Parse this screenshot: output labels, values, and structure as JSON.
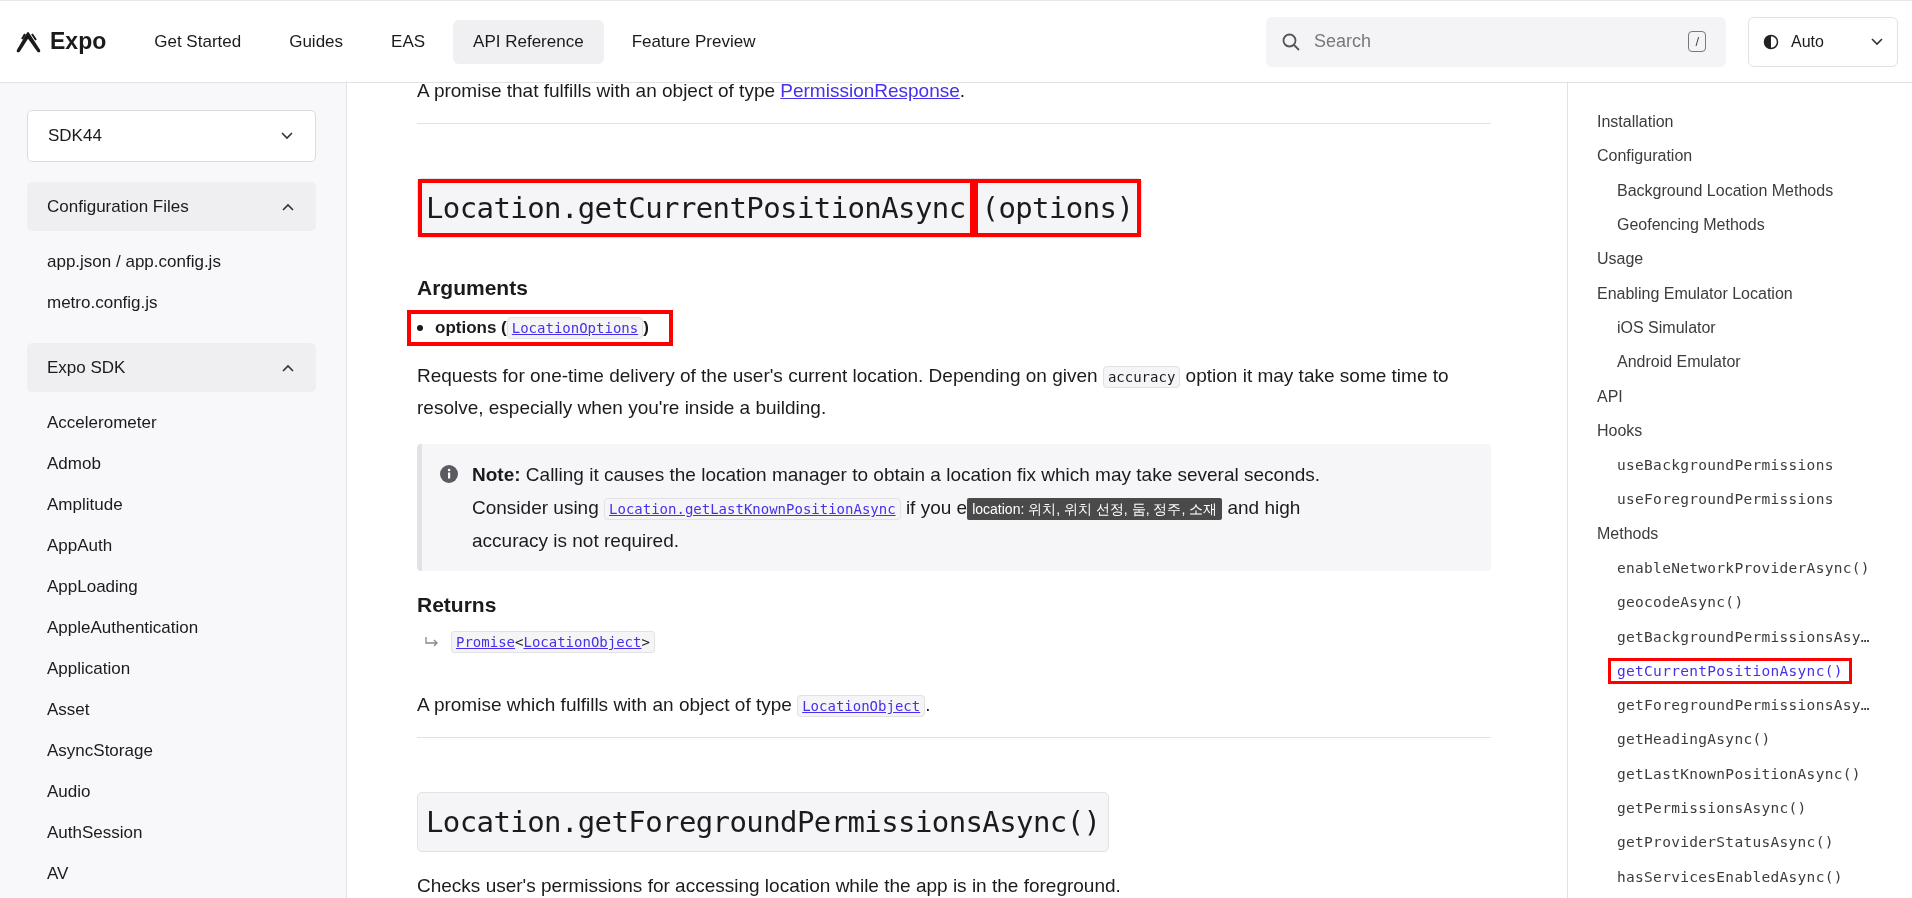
{
  "header": {
    "logo": "Expo",
    "nav": [
      {
        "label": "Get Started",
        "selected": false
      },
      {
        "label": "Guides",
        "selected": false
      },
      {
        "label": "EAS",
        "selected": false
      },
      {
        "label": "API Reference",
        "selected": true
      },
      {
        "label": "Feature Preview",
        "selected": false
      }
    ],
    "search": {
      "placeholder": "Search",
      "shortcut": "/"
    },
    "theme": {
      "value": "Auto"
    }
  },
  "sidebar": {
    "version": "SDK44",
    "sections": [
      {
        "title": "Configuration Files",
        "expanded": true,
        "items": [
          "app.json / app.config.js",
          "metro.config.js"
        ]
      },
      {
        "title": "Expo SDK",
        "expanded": true,
        "items": [
          "Accelerometer",
          "Admob",
          "Amplitude",
          "AppAuth",
          "AppLoading",
          "AppleAuthentication",
          "Application",
          "Asset",
          "AsyncStorage",
          "Audio",
          "AuthSession",
          "AV"
        ]
      }
    ]
  },
  "content": [
    {
      "kind": "paragraph",
      "parts": [
        {
          "kind": "text",
          "text": "A promise that fulfills with an object of type "
        },
        {
          "kind": "link",
          "text": "PermissionResponse"
        },
        {
          "kind": "text",
          "text": "."
        }
      ]
    },
    {
      "kind": "divider"
    },
    {
      "kind": "heading",
      "parts": [
        {
          "text": "Location.getCurrentPositionAsync",
          "annotated": true
        },
        {
          "text": "(options)",
          "annotated": true
        }
      ]
    },
    {
      "kind": "subheading",
      "text": "Arguments"
    },
    {
      "kind": "bullet",
      "annotated": true,
      "parts": [
        {
          "kind": "bold",
          "text": "options ("
        },
        {
          "kind": "codelink",
          "text": "LocationOptions"
        },
        {
          "kind": "bold",
          "text": ")"
        }
      ]
    },
    {
      "kind": "paragraph",
      "parts": [
        {
          "kind": "text",
          "text": "Requests for one-time delivery of the user's current location. Depending on given "
        },
        {
          "kind": "code",
          "text": "accuracy"
        },
        {
          "kind": "text",
          "text": " option it may take some time to resolve, especially when you're inside a building."
        }
      ]
    },
    {
      "kind": "note",
      "parts": [
        {
          "kind": "bold",
          "text": "Note:"
        },
        {
          "kind": "text",
          "text": " Calling it causes the location manager to obtain a location fix which may take several seconds. Consider using "
        },
        {
          "kind": "codelink",
          "text": "Location.getLastKnownPositionAsync"
        },
        {
          "kind": "text",
          "text": " if you e"
        },
        {
          "kind": "tooltip",
          "text": "location: 위치, 위치 선정, 둠, 정주, 소재"
        },
        {
          "kind": "text",
          "text": " and high accuracy is not required."
        }
      ]
    },
    {
      "kind": "subheading",
      "text": "Returns"
    },
    {
      "kind": "returns",
      "parts": [
        {
          "kind": "codelink",
          "text": "Promise"
        },
        {
          "kind": "text",
          "text": "<"
        },
        {
          "kind": "codelink",
          "text": "LocationObject"
        },
        {
          "kind": "text",
          "text": ">"
        }
      ]
    },
    {
      "kind": "paragraph",
      "parts": [
        {
          "kind": "text",
          "text": "A promise which fulfills with an object of type "
        },
        {
          "kind": "codelink",
          "text": "LocationObject"
        },
        {
          "kind": "text",
          "text": "."
        }
      ]
    },
    {
      "kind": "divider"
    },
    {
      "kind": "heading",
      "parts": [
        {
          "text": "Location.getForegroundPermissionsAsync()",
          "annotated": false
        }
      ]
    },
    {
      "kind": "paragraph",
      "parts": [
        {
          "kind": "text",
          "text": "Checks user's permissions for accessing location while the app is in the foreground."
        }
      ]
    }
  ],
  "toc": [
    {
      "label": "Installation",
      "kind": "text",
      "selected": false,
      "annotated": false
    },
    {
      "label": "Configuration",
      "kind": "text",
      "selected": false,
      "annotated": false,
      "children": [
        {
          "label": "Background Location Methods",
          "kind": "text",
          "selected": false,
          "annotated": false
        },
        {
          "label": "Geofencing Methods",
          "kind": "text",
          "selected": false,
          "annotated": false
        }
      ]
    },
    {
      "label": "Usage",
      "kind": "text",
      "selected": false,
      "annotated": false
    },
    {
      "label": "Enabling Emulator Location",
      "kind": "text",
      "selected": false,
      "annotated": false,
      "children": [
        {
          "label": "iOS Simulator",
          "kind": "text",
          "selected": false,
          "annotated": false
        },
        {
          "label": "Android Emulator",
          "kind": "text",
          "selected": false,
          "annotated": false
        }
      ]
    },
    {
      "label": "API",
      "kind": "text",
      "selected": false,
      "annotated": false
    },
    {
      "label": "Hooks",
      "kind": "text",
      "selected": false,
      "annotated": false,
      "children": [
        {
          "label": "useBackgroundPermissions",
          "kind": "code",
          "selected": false,
          "annotated": false
        },
        {
          "label": "useForegroundPermissions",
          "kind": "code",
          "selected": false,
          "annotated": false
        }
      ]
    },
    {
      "label": "Methods",
      "kind": "text",
      "selected": false,
      "annotated": false,
      "children": [
        {
          "label": "enableNetworkProviderAsync()",
          "kind": "code",
          "selected": false,
          "annotated": false
        },
        {
          "label": "geocodeAsync()",
          "kind": "code",
          "selected": false,
          "annotated": false
        },
        {
          "label": "getBackgroundPermissionsAsy…",
          "kind": "code",
          "selected": false,
          "annotated": false
        },
        {
          "label": "getCurrentPositionAsync()",
          "kind": "code",
          "selected": true,
          "annotated": true
        },
        {
          "label": "getForegroundPermissionsAsy…",
          "kind": "code",
          "selected": false,
          "annotated": false
        },
        {
          "label": "getHeadingAsync()",
          "kind": "code",
          "selected": false,
          "annotated": false
        },
        {
          "label": "getLastKnownPositionAsync()",
          "kind": "code",
          "selected": false,
          "annotated": false
        },
        {
          "label": "getPermissionsAsync()",
          "kind": "code",
          "selected": false,
          "annotated": false
        },
        {
          "label": "getProviderStatusAsync()",
          "kind": "code",
          "selected": false,
          "annotated": false
        },
        {
          "label": "hasServicesEnabledAsync()",
          "kind": "code",
          "selected": false,
          "annotated": false
        }
      ]
    }
  ]
}
